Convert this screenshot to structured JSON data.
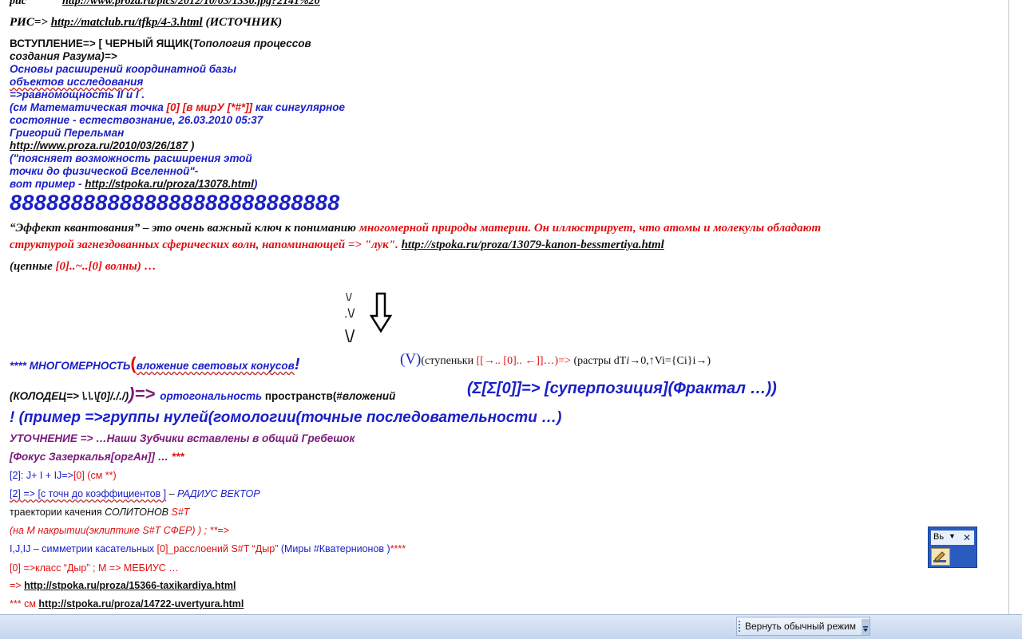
{
  "document": {
    "line_ris_label": "рис",
    "line_ris_url": "http://www.proza.ru/pics/2012/10/03/1330.jpg?2141%20",
    "line2_prefix": "РИС=>",
    "line2_url": "http://matclub.ru/tfkp/4-3.html",
    "line2_suffix": "(ИСТОЧНИК)",
    "intro_a": "ВСТУПЛЕНИЕ=> [ ЧЕРНЫЙ ЯЩИК(",
    "intro_b": "Топология процессов",
    "intro_c": "создания Разума)=>",
    "blue1": "Основы расширений координатной базы",
    "blue2": "объектов исследования",
    "blue3": "=>равномощность II и I .",
    "see_a": "(см Математическая точка ",
    "see_b": "[0] [в мирУ [*#*]]",
    "see_c": " как сингулярное",
    "state_line": "состояние - естествознание, 26.03.2010 05:37",
    "author": "Григорий Перельман",
    "author_url": "http://www.proza.ru/2010/03/26/187",
    "author_close": " )",
    "quote1": "(\"поясняет возможность расширения этой",
    "quote2": "точки до физической Вселенной\"-",
    "example_prefix": "вот пример - ",
    "example_url": "http://stpoka.ru/proza/13078.html",
    "example_close": ")",
    "eights": "888888888888888888888888888",
    "effect_a": "“Эффект квантования” – это очень важный ключ к пониманию ",
    "effect_b": "многомерной природы материи. Он иллюстрирует, что атомы и молекулы обладают",
    "effect_c": "структурой загнездованных сферических волн, напоминающей => \"лук\". ",
    "effect_url": "http://stpoka.ru/proza/13079-kanon-bessmertiya.html",
    "chain_a": "(цепные ",
    "chain_b": "[0]..~..[0] волны)",
    "chain_c": " …",
    "glyph1": "\\/",
    "glyph2": ".\\/",
    "glyph3": "\\/",
    "multi_stars": "****",
    "multi_word": " МНОГОМЕРНОСТЬ",
    "multi_paren": "(",
    "multi_text": "вложение световых конусов",
    "multi_bang": "!",
    "v_paren": "(V)",
    "steps_text": "(ступеньки ",
    "steps_red": "[[→.. [0].. ←]]…)=>",
    "raster_text": " (растры dT",
    "raster_i": "i",
    "raster_rest": "→0,↑Vi={Ci}i→)",
    "well_a": "(КОЛОДЕЦ=> \\.\\.\\[0]/./.",
    "well_paren": "/)",
    "well_b": ")=> ",
    "orth": "ортогональность",
    "space": " пространств(#",
    "nest": "вложений",
    "sigma": "(Σ[Σ[0]]=> [суперпозиция](Фрактал …))",
    "example_line": "! (пример =>группы нулей(гомологии(точные последовательности …)",
    "refine": "УТОЧНЕНИЕ => …Наши Зубчики вставлены в общий Гребешок",
    "focus_a": "[Фокус Зазеркалья[оргАн]] …",
    "focus_b": " ***",
    "eq_a": "[2]: J+ I + IJ=>",
    "eq_b": "[0] (см **)",
    "coef_a": "[2] => [с точн до коэффициентов ]",
    "coef_b": " – ",
    "coef_c": "РАДИУС ВЕКТОР",
    "traj_a": "траектории качения ",
    "traj_b": "СОЛИТОНОВ ",
    "traj_c": "S#T",
    "cover": "(на М  накрытии(эклиптике S#T СФЕР) ) ; **=>",
    "sym_a": "I,J,IJ – симметрии касательных ",
    "sym_b": "[0]_расслоений S#T “Дыр”",
    "sym_c": " (Миры #Кватернионов )",
    "sym_d": "****",
    "klass_a": "[0] =>класс “Дыр” ; М => МЕБИУС …",
    "link1_prefix": "=> ",
    "link1_url": "http://stpoka.ru/proza/15366-taxikardiya.html",
    "link2_prefix": "*** см ",
    "link2_url": "http://stpoka.ru/proza/14722-uvertyura.html"
  },
  "mini_toolbar": {
    "style_label": "Вь",
    "dropdown_glyph": "▼",
    "close_glyph": "✕"
  },
  "taskbar": {
    "restore_label": "Вернуть обычный режим"
  },
  "colors": {
    "red": "#e01010",
    "blue": "#1a20c8",
    "purple": "#7a1a7a",
    "taskbar": "#c4d6ee",
    "toolbar_blue": "#2a5cbf"
  }
}
